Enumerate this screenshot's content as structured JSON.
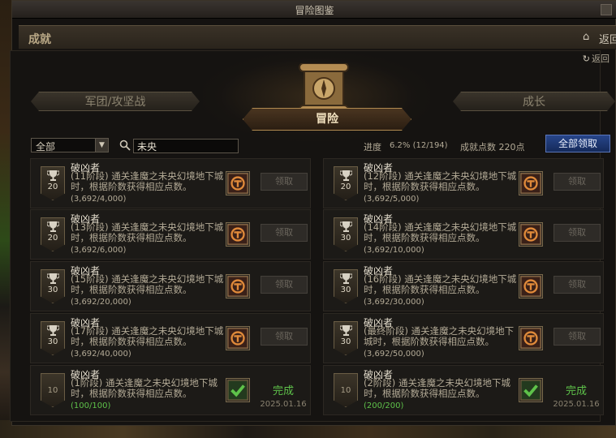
{
  "window": {
    "title": "冒险图鉴"
  },
  "header": {
    "section_title": "成就",
    "back_label": "返回"
  },
  "panel": {
    "back_link": "返回"
  },
  "tabs": {
    "left": "军团/攻坚战",
    "center": "冒险",
    "right": "成长"
  },
  "filter": {
    "selected": "全部",
    "search_value": "未央"
  },
  "progress": {
    "label": "进度",
    "value": "6.2% (12/194)",
    "fraction": 0.062
  },
  "points": {
    "text": "成就点数 220点"
  },
  "claim_all": {
    "label": "全部领取"
  },
  "cards": [
    {
      "name": "破凶者",
      "badge": "20",
      "desc": "(11阶段) 通关逢魔之未央幻境地下城时，根据阶数获得相应点数。",
      "progress": "(3,692/4,000)",
      "action": "领取",
      "completed": false,
      "date": ""
    },
    {
      "name": "破凶者",
      "badge": "20",
      "desc": "(12阶段) 通关逢魔之未央幻境地下城时，根据阶数获得相应点数。",
      "progress": "(3,692/5,000)",
      "action": "领取",
      "completed": false,
      "date": ""
    },
    {
      "name": "破凶者",
      "badge": "20",
      "desc": "(13阶段) 通关逢魔之未央幻境地下城时，根据阶数获得相应点数。",
      "progress": "(3,692/6,000)",
      "action": "领取",
      "completed": false,
      "date": ""
    },
    {
      "name": "破凶者",
      "badge": "30",
      "desc": "(14阶段) 通关逢魔之未央幻境地下城时，根据阶数获得相应点数。",
      "progress": "(3,692/10,000)",
      "action": "领取",
      "completed": false,
      "date": ""
    },
    {
      "name": "破凶者",
      "badge": "30",
      "desc": "(15阶段) 通关逢魔之未央幻境地下城时，根据阶数获得相应点数。",
      "progress": "(3,692/20,000)",
      "action": "领取",
      "completed": false,
      "date": ""
    },
    {
      "name": "破凶者",
      "badge": "30",
      "desc": "(16阶段) 通关逢魔之未央幻境地下城时，根据阶数获得相应点数。",
      "progress": "(3,692/30,000)",
      "action": "领取",
      "completed": false,
      "date": ""
    },
    {
      "name": "破凶者",
      "badge": "30",
      "desc": "(17阶段) 通关逢魔之未央幻境地下城时，根据阶数获得相应点数。",
      "progress": "(3,692/40,000)",
      "action": "领取",
      "completed": false,
      "date": ""
    },
    {
      "name": "破凶者",
      "badge": "30",
      "desc": "(最终阶段) 通关逢魔之未央幻境地下城时，根据阶数获得相应点数。",
      "progress": "(3,692/50,000)",
      "action": "领取",
      "completed": false,
      "date": ""
    },
    {
      "name": "破凶者",
      "badge": "10",
      "desc": "(1阶段) 通关逢魔之未央幻境地下城时，根据阶数获得相应点数。",
      "progress": "(100/100)",
      "action": "完成",
      "completed": true,
      "date": "2025.01.16"
    },
    {
      "name": "破凶者",
      "badge": "10",
      "desc": "(2阶段) 通关逢魔之未央幻境地下城时，根据阶数获得相应点数。",
      "progress": "(200/200)",
      "action": "完成",
      "completed": true,
      "date": "2025.01.16"
    }
  ],
  "colors": {
    "accent_blue": "#27458a",
    "done_green": "#5ec24a",
    "gold_border": "#b08a50"
  }
}
